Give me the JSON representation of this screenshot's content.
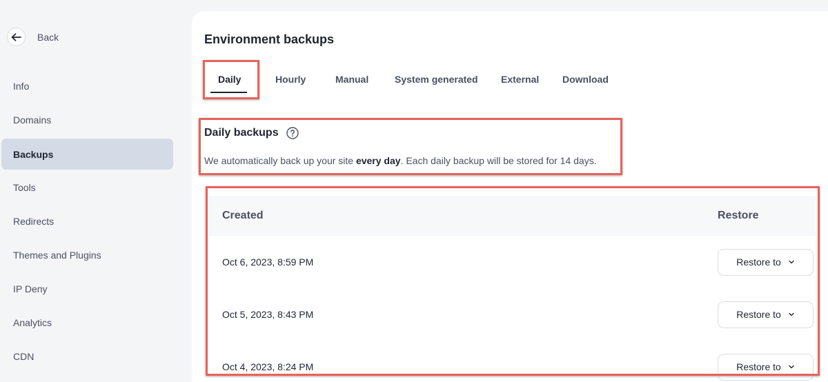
{
  "sidebar": {
    "back_label": "Back",
    "items": [
      {
        "label": "Info"
      },
      {
        "label": "Domains"
      },
      {
        "label": "Backups"
      },
      {
        "label": "Tools"
      },
      {
        "label": "Redirects"
      },
      {
        "label": "Themes and Plugins"
      },
      {
        "label": "IP Deny"
      },
      {
        "label": "Analytics"
      },
      {
        "label": "CDN"
      }
    ],
    "active_item": "Backups"
  },
  "main": {
    "title": "Environment backups",
    "tabs": [
      {
        "label": "Daily"
      },
      {
        "label": "Hourly"
      },
      {
        "label": "Manual"
      },
      {
        "label": "System generated"
      },
      {
        "label": "External"
      },
      {
        "label": "Download"
      }
    ],
    "active_tab": "Daily",
    "section": {
      "title": "Daily backups",
      "desc_before": "We automatically back up your site ",
      "desc_bold": "every day",
      "desc_after": ". Each daily backup will be stored for 14 days."
    },
    "table": {
      "headers": {
        "created": "Created",
        "restore": "Restore"
      },
      "rows": [
        {
          "created": "Oct 6, 2023, 8:59 PM",
          "action": "Restore to"
        },
        {
          "created": "Oct 5, 2023, 8:43 PM",
          "action": "Restore to"
        },
        {
          "created": "Oct 4, 2023, 8:24 PM",
          "action": "Restore to"
        }
      ]
    }
  },
  "colors": {
    "highlight": "#e8625a",
    "active_nav_bg": "#d5dbe6",
    "panel_bg": "#ffffff",
    "page_bg": "#f4f5f7"
  },
  "icons": {
    "back": "arrow-left-icon",
    "help": "question-circle-icon",
    "chevron": "chevron-down-icon"
  }
}
